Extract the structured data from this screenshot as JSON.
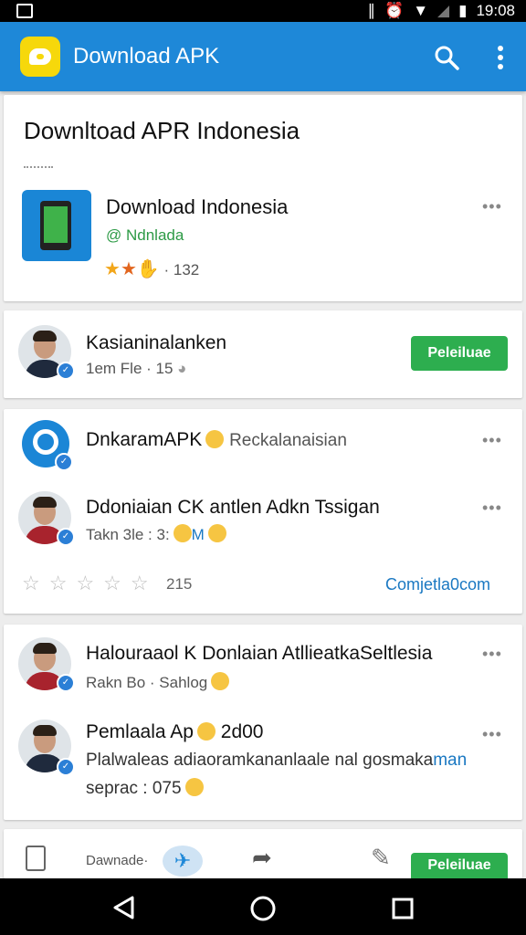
{
  "status_bar": {
    "time": "19:08"
  },
  "app_bar": {
    "title": "Download APK",
    "icons": [
      "search-icon",
      "more-vert-icon"
    ]
  },
  "header_card": {
    "title": "Downltoad APR Indonesia",
    "app": {
      "name": "Download Indonesia",
      "developer": "@ Ndnlada",
      "rating_count": "· 132"
    }
  },
  "posts": [
    {
      "name": "Kasianinalanken",
      "meta": "1em Fle · 15",
      "button": "Peleiluae"
    },
    {
      "name": "DnkaramAPK",
      "extra": "Reckalanaisian"
    },
    {
      "name": "Ddoniaian CK antlen Adkn Tssigan",
      "meta": "Takn 3le : 3:",
      "meta_extra": "M",
      "rating": "215",
      "link": "Comjetla0com"
    },
    {
      "name": "Halouraaol K Donlaian AtllieatkaSeltlesia",
      "meta": "Rakn Bo · Sahlog"
    },
    {
      "name": "Pemlaala Ap",
      "name_extra": "2d00",
      "body_1": "Plalwaleas adiaoramkananlaale nal gosmaka",
      "body_1_link": "man",
      "body_2": "seprac : 075"
    }
  ],
  "bottom_card": {
    "label": "Dawnade·",
    "button": "Peleiluae"
  },
  "colors": {
    "primary": "#1e88d8",
    "accent": "#2dae4f",
    "link": "#1a78c2"
  }
}
